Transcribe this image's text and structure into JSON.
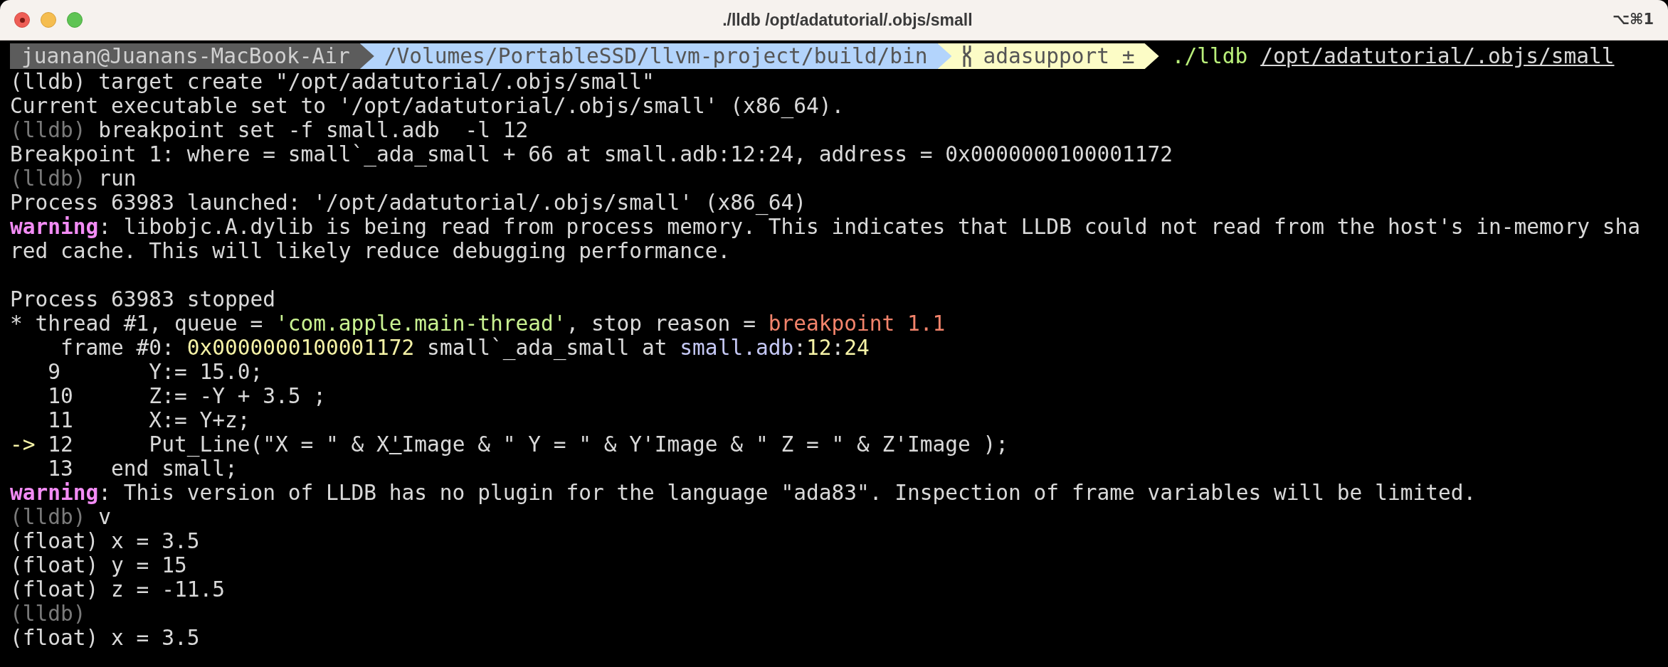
{
  "window": {
    "title": "./lldb /opt/adatutorial/.objs/small",
    "shortcut": "⌥⌘1"
  },
  "prompt": {
    "segments": [
      {
        "kind": "user",
        "text": "juanan@Juanans-MacBook-Air"
      },
      {
        "kind": "path",
        "text": "/Volumes/PortableSSD/llvm-project/build/bin"
      },
      {
        "kind": "git",
        "text": "adasupport ±"
      }
    ],
    "command": "./lldb",
    "argument": "/opt/adatutorial/.objs/small"
  },
  "lines": [
    {
      "kind": "text",
      "segments": [
        {
          "kind": "plain",
          "text": "(lldb) target create \"/opt/adatutorial/.objs/small\""
        }
      ]
    },
    {
      "kind": "text",
      "segments": [
        {
          "kind": "plain",
          "text": "Current executable set to '/opt/adatutorial/.objs/small' (x86_64)."
        }
      ]
    },
    {
      "kind": "text",
      "segments": [
        {
          "kind": "prompt",
          "text": "(lldb)"
        },
        {
          "kind": "plain",
          "text": " breakpoint set -f small.adb  -l 12"
        }
      ]
    },
    {
      "kind": "text",
      "segments": [
        {
          "kind": "plain",
          "text": "Breakpoint 1: where = small`_ada_small + 66 at small.adb:12:24, address = 0x0000000100001172"
        }
      ]
    },
    {
      "kind": "text",
      "segments": [
        {
          "kind": "prompt",
          "text": "(lldb)"
        },
        {
          "kind": "plain",
          "text": " run"
        }
      ]
    },
    {
      "kind": "text",
      "segments": [
        {
          "kind": "plain",
          "text": "Process 63983 launched: '/opt/adatutorial/.objs/small' (x86_64)"
        }
      ]
    },
    {
      "kind": "text",
      "segments": [
        {
          "kind": "warning",
          "text": "warning"
        },
        {
          "kind": "plain",
          "text": ": libobjc.A.dylib is being read from process memory. This indicates that LLDB could not read from the host's in-memory sha"
        }
      ]
    },
    {
      "kind": "text",
      "segments": [
        {
          "kind": "plain",
          "text": "red cache. This will likely reduce debugging performance."
        }
      ]
    },
    {
      "kind": "blank"
    },
    {
      "kind": "text",
      "segments": [
        {
          "kind": "plain",
          "text": "Process 63983 stopped"
        }
      ]
    },
    {
      "kind": "text",
      "segments": [
        {
          "kind": "plain",
          "text": "* thread #1, queue = "
        },
        {
          "kind": "string",
          "text": "'com.apple.main-thread'"
        },
        {
          "kind": "plain",
          "text": ", stop reason = "
        },
        {
          "kind": "reason",
          "text": "breakpoint 1.1"
        }
      ]
    },
    {
      "kind": "text",
      "segments": [
        {
          "kind": "plain",
          "text": "    frame #0: "
        },
        {
          "kind": "address",
          "text": "0x0000000100001172"
        },
        {
          "kind": "plain",
          "text": " small`_ada_small at "
        },
        {
          "kind": "file",
          "text": "small.adb"
        },
        {
          "kind": "plain",
          "text": ":"
        },
        {
          "kind": "address",
          "text": "12"
        },
        {
          "kind": "plain",
          "text": ":"
        },
        {
          "kind": "address",
          "text": "24"
        }
      ]
    },
    {
      "kind": "text",
      "segments": [
        {
          "kind": "plain",
          "text": "   9       Y:= 15.0;"
        }
      ]
    },
    {
      "kind": "text",
      "segments": [
        {
          "kind": "plain",
          "text": "   10      Z:= -Y + 3.5 ;"
        }
      ]
    },
    {
      "kind": "text",
      "segments": [
        {
          "kind": "plain",
          "text": "   11      X:= Y+z;"
        }
      ]
    },
    {
      "kind": "text",
      "segments": [
        {
          "kind": "arrow",
          "text": "->"
        },
        {
          "kind": "plain",
          "text": " 12      Put_Line(\"X = \" & X"
        },
        {
          "kind": "marked",
          "text": "'"
        },
        {
          "kind": "plain",
          "text": "Image & \" Y = \" & Y'Image & \" Z = \" & Z'Image );"
        }
      ]
    },
    {
      "kind": "text",
      "segments": [
        {
          "kind": "plain",
          "text": "   13   end small;"
        }
      ]
    },
    {
      "kind": "text",
      "segments": [
        {
          "kind": "warning",
          "text": "warning"
        },
        {
          "kind": "plain",
          "text": ": This version of LLDB has no plugin for the language \"ada83\". Inspection of frame variables will be limited."
        }
      ]
    },
    {
      "kind": "text",
      "segments": [
        {
          "kind": "prompt",
          "text": "(lldb)"
        },
        {
          "kind": "plain",
          "text": " v"
        }
      ]
    },
    {
      "kind": "text",
      "segments": [
        {
          "kind": "plain",
          "text": "(float) x = 3.5"
        }
      ]
    },
    {
      "kind": "text",
      "segments": [
        {
          "kind": "plain",
          "text": "(float) y = 15"
        }
      ]
    },
    {
      "kind": "text",
      "segments": [
        {
          "kind": "plain",
          "text": "(float) z = -11.5"
        }
      ]
    },
    {
      "kind": "text",
      "segments": [
        {
          "kind": "prompt",
          "text": "(lldb)"
        }
      ]
    },
    {
      "kind": "text",
      "segments": [
        {
          "kind": "plain",
          "text": "(float) x = 3.5"
        }
      ]
    }
  ]
}
